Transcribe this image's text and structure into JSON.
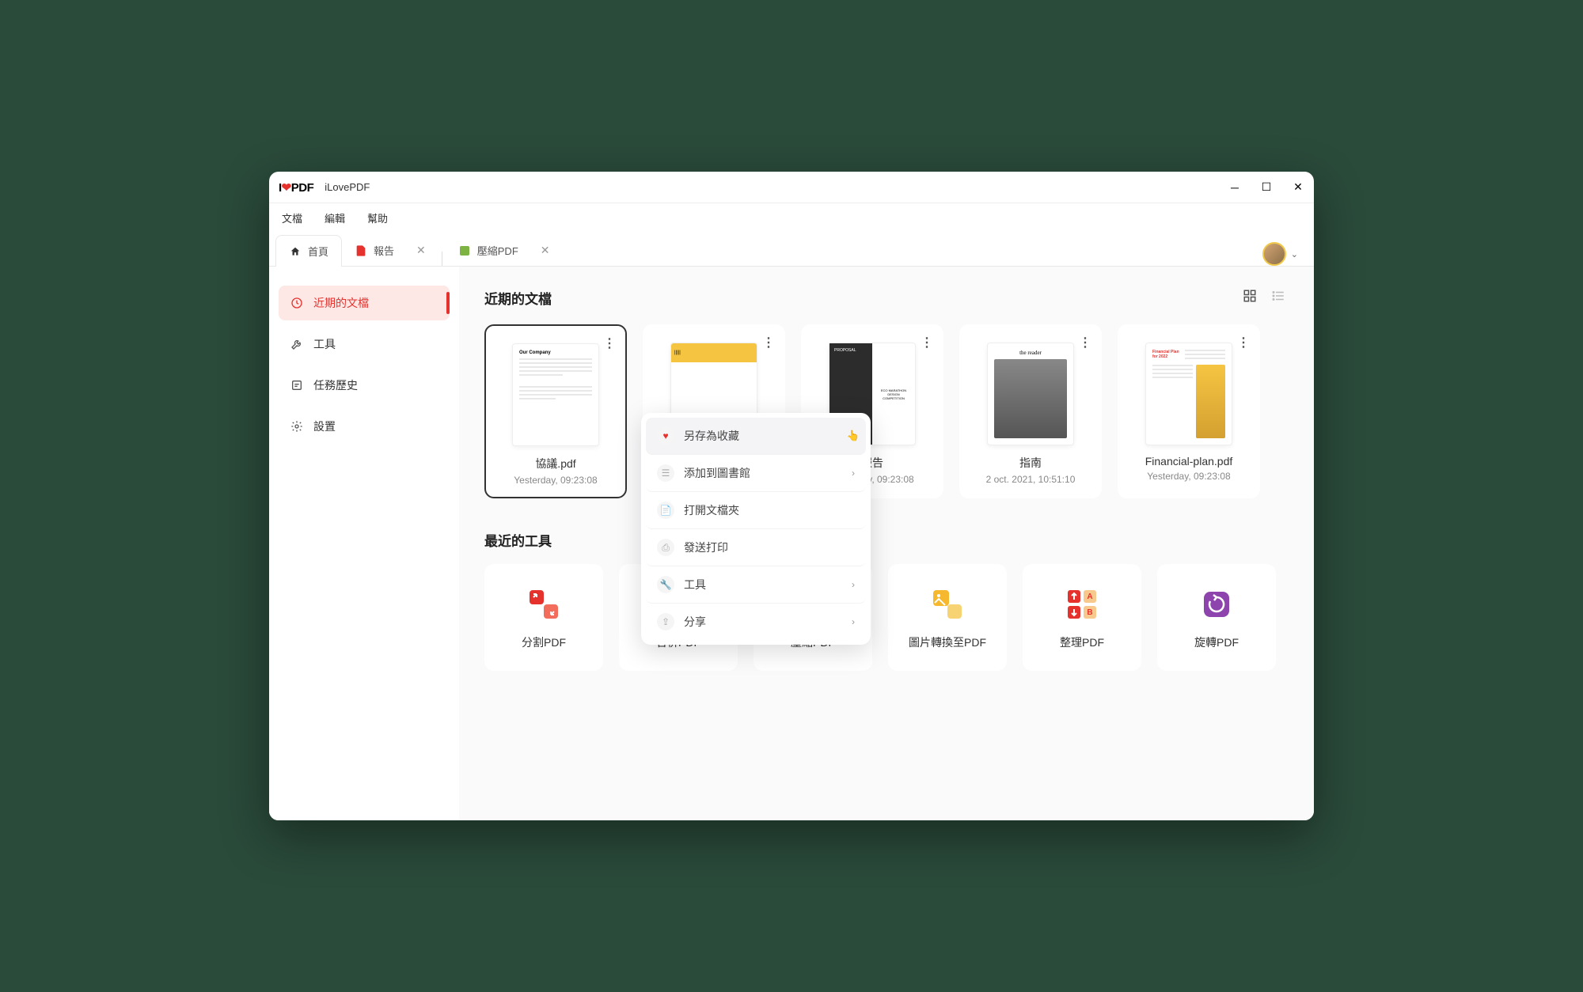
{
  "app": {
    "logo_i": "I",
    "logo_pdf": "PDF",
    "name": "iLovePDF"
  },
  "menu": {
    "file": "文檔",
    "edit": "編輯",
    "help": "幫助"
  },
  "tabs": {
    "home": "首頁",
    "report": "報告",
    "compress": "壓縮PDF"
  },
  "sidebar": {
    "recent": "近期的文檔",
    "tools": "工具",
    "history": "任務歷史",
    "settings": "設置"
  },
  "section": {
    "recent_title": "近期的文檔",
    "tools_title": "最近的工具"
  },
  "docs": [
    {
      "name": "協議.pdf",
      "date": "Yesterday, 09:23:08"
    },
    {
      "name": "",
      "date": ""
    },
    {
      "name": "報告",
      "date": "Yesterday, 09:23:08"
    },
    {
      "name": "指南",
      "date": "2 oct. 2021, 10:51:10"
    },
    {
      "name": "Financial-plan.pdf",
      "date": "Yesterday, 09:23:08"
    }
  ],
  "thumbs": {
    "reader": "the reader",
    "proposal": "PROPOSAL",
    "eco": "ECO MARATHON DESIGN COMPETITION",
    "fin_title": "Financial Plan for 2022"
  },
  "context": {
    "favorite": "另存為收藏",
    "library": "添加到圖書館",
    "open_folder": "打開文檔夾",
    "print": "發送打印",
    "tools": "工具",
    "share": "分享"
  },
  "tools": [
    {
      "label": "分割PDF",
      "color": "#e5322d"
    },
    {
      "label": "合併PDF",
      "color": "#e5322d"
    },
    {
      "label": "壓縮PDF",
      "color": "#7cb342"
    },
    {
      "label": "圖片轉換至PDF",
      "color": "#f5b82e"
    },
    {
      "label": "整理PDF",
      "color": "#e5322d"
    },
    {
      "label": "旋轉PDF",
      "color": "#8e44ad"
    }
  ]
}
